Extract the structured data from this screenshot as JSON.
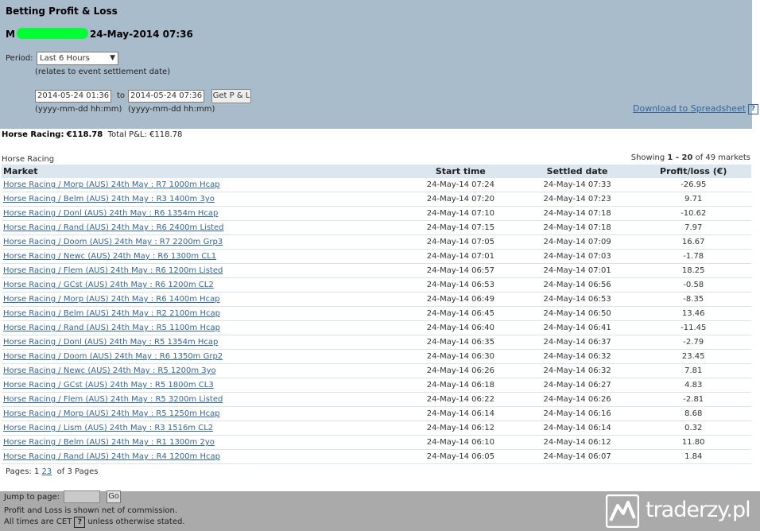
{
  "header": {
    "title": "Betting Profit & Loss",
    "account_prefix": "M",
    "account_datetime": "24-May-2014 07:36",
    "period_label": "Period:",
    "period_value": "Last 6 Hours",
    "period_note": "(relates to event settlement date)",
    "from_date": "2014-05-24 01:36",
    "to_label": "to",
    "to_date": "2014-05-24 07:36",
    "get_button": "Get P & L",
    "from_format": "(yyyy-mm-dd hh:mm)",
    "to_format": "(yyyy-mm-dd hh:mm)",
    "download_link": "Download to Spreadsheet",
    "help": "?"
  },
  "summary": {
    "sport_label": "Horse Racing:",
    "sport_value": "€118.78",
    "total_label": "Total P&L:",
    "total_value": "€118.78"
  },
  "section": {
    "name": "Horse Racing",
    "showing_prefix": "Showing",
    "showing_range": "1 - 20",
    "showing_suffix": "of 49 markets"
  },
  "table": {
    "headers": [
      "Market",
      "Start time",
      "Settled date",
      "Profit/loss (€)"
    ],
    "rows": [
      [
        "Horse Racing / Morp (AUS) 24th May : R7 1000m Hcap",
        "24-May-14 07:24",
        "24-May-14 07:33",
        "-26.95"
      ],
      [
        "Horse Racing / Belm (AUS) 24th May : R3 1400m 3yo",
        "24-May-14 07:20",
        "24-May-14 07:23",
        "9.71"
      ],
      [
        "Horse Racing / Donl (AUS) 24th May : R6 1354m Hcap",
        "24-May-14 07:10",
        "24-May-14 07:18",
        "-10.62"
      ],
      [
        "Horse Racing / Rand (AUS) 24th May : R6 2400m Listed",
        "24-May-14 07:15",
        "24-May-14 07:18",
        "7.97"
      ],
      [
        "Horse Racing / Doom (AUS) 24th May : R7 2200m Grp3",
        "24-May-14 07:05",
        "24-May-14 07:09",
        "16.67"
      ],
      [
        "Horse Racing / Newc (AUS) 24th May : R6 1300m CL1",
        "24-May-14 07:01",
        "24-May-14 07:03",
        "-1.78"
      ],
      [
        "Horse Racing / Flem (AUS) 24th May : R6 1200m Listed",
        "24-May-14 06:57",
        "24-May-14 07:01",
        "18.25"
      ],
      [
        "Horse Racing / GCst (AUS) 24th May : R6 1200m CL2",
        "24-May-14 06:53",
        "24-May-14 06:56",
        "-0.58"
      ],
      [
        "Horse Racing / Morp (AUS) 24th May : R6 1400m Hcap",
        "24-May-14 06:49",
        "24-May-14 06:53",
        "-8.35"
      ],
      [
        "Horse Racing / Belm (AUS) 24th May : R2 2100m Hcap",
        "24-May-14 06:45",
        "24-May-14 06:50",
        "13.46"
      ],
      [
        "Horse Racing / Rand (AUS) 24th May : R5 1100m Hcap",
        "24-May-14 06:40",
        "24-May-14 06:41",
        "-11.45"
      ],
      [
        "Horse Racing / Donl (AUS) 24th May : R5 1354m Hcap",
        "24-May-14 06:35",
        "24-May-14 06:37",
        "-2.79"
      ],
      [
        "Horse Racing / Doom (AUS) 24th May : R6 1350m Grp2",
        "24-May-14 06:30",
        "24-May-14 06:32",
        "23.45"
      ],
      [
        "Horse Racing / Newc (AUS) 24th May : R5 1200m 3yo",
        "24-May-14 06:26",
        "24-May-14 06:32",
        "7.81"
      ],
      [
        "Horse Racing / GCst (AUS) 24th May : R5 1800m CL3",
        "24-May-14 06:18",
        "24-May-14 06:27",
        "4.83"
      ],
      [
        "Horse Racing / Flem (AUS) 24th May : R5 3200m Listed",
        "24-May-14 06:22",
        "24-May-14 06:26",
        "-2.81"
      ],
      [
        "Horse Racing / Morp (AUS) 24th May : R5 1250m Hcap",
        "24-May-14 06:14",
        "24-May-14 06:16",
        "8.68"
      ],
      [
        "Horse Racing / Lism (AUS) 24th May : R3 1516m CL2",
        "24-May-14 06:12",
        "24-May-14 06:14",
        "0.32"
      ],
      [
        "Horse Racing / Belm (AUS) 24th May : R1 1300m 2yo",
        "24-May-14 06:10",
        "24-May-14 06:12",
        "11.80"
      ],
      [
        "Horse Racing / Rand (AUS) 24th May : R4 1200m Hcap",
        "24-May-14 06:05",
        "24-May-14 06:07",
        "1.84"
      ]
    ]
  },
  "pagination": {
    "label": "Pages:",
    "current": "1",
    "others": [
      "2",
      "3"
    ],
    "suffix": "of 3 Pages"
  },
  "footer": {
    "jump_label": "Jump to page:",
    "go_button": "Go",
    "note_commission": "Profit and Loss is shown net of commission.",
    "note_time_prefix": "All times are CET",
    "note_time_help": "?",
    "note_time_suffix": "unless otherwise stated.",
    "watermark": "traderzy.pl"
  },
  "colors": {
    "header_bg": "#a9bccc",
    "table_header_bg": "#dce6ee",
    "link": "#336699",
    "footer_bg": "#aaaaaa",
    "mask": "#00ff33"
  }
}
